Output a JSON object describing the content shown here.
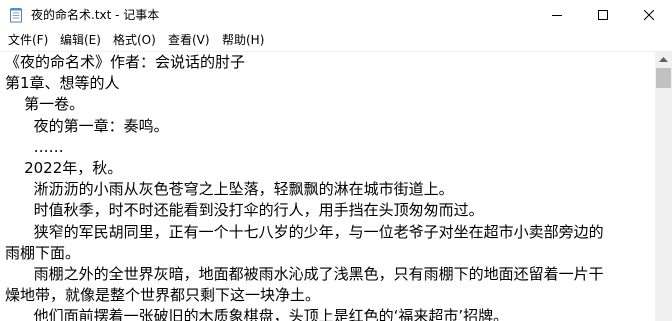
{
  "window": {
    "title": "夜的命名术.txt - 记事本"
  },
  "menu": {
    "items": [
      {
        "label": "文件(F)"
      },
      {
        "label": "编辑(E)"
      },
      {
        "label": "格式(O)"
      },
      {
        "label": "查看(V)"
      },
      {
        "label": "帮助(H)"
      }
    ]
  },
  "document": {
    "lines": [
      "《夜的命名术》作者：会说话的肘子",
      "第1章、想等的人",
      "    第一卷。",
      "      夜的第一章：奏鸣。",
      "      ……",
      "    2022年，秋。",
      "      淅沥沥的小雨从灰色苍穹之上坠落，轻飘飘的淋在城市街道上。",
      "      时值秋季，时不时还能看到没打伞的行人，用手挡在头顶匆匆而过。",
      "      狭窄的军民胡同里，正有一个十七八岁的少年，与一位老爷子对坐在超市小卖部旁边的",
      "雨棚下面。",
      "      雨棚之外的全世界灰暗，地面都被雨水沁成了浅黑色，只有雨棚下的地面还留着一片干",
      "燥地带，就像是整个世界都只剩下这一块净土。",
      "      他们面前摆着一张破旧的木质象棋盘，头顶上是红色的‘福来超市’招牌。"
    ]
  },
  "icons": {
    "app": "notepad-icon",
    "minimize": "minimize-icon",
    "maximize": "maximize-icon",
    "close": "close-icon",
    "scroll_up": "scroll-up-arrow-icon"
  }
}
